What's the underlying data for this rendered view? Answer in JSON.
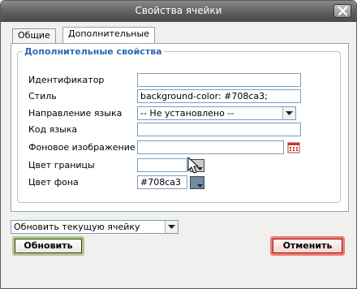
{
  "window": {
    "title": "Свойства ячейки"
  },
  "tabs": [
    {
      "label": "Общие"
    },
    {
      "label": "Дополнительные"
    }
  ],
  "fieldset": {
    "legend": "Дополнительные свойства"
  },
  "fields": {
    "id": {
      "label": "Идентификатор",
      "value": ""
    },
    "style": {
      "label": "Стиль",
      "value": "background-color: #708ca3;"
    },
    "dir": {
      "label": "Направление языка",
      "value": "-- Не установлено --"
    },
    "lang": {
      "label": "Код языка",
      "value": ""
    },
    "bgimage": {
      "label": "Фоновое изображение",
      "value": ""
    },
    "bordercolor": {
      "label": "Цвет границы",
      "value": ""
    },
    "bgcolor": {
      "label": "Цвет фона",
      "value": "#708ca3"
    }
  },
  "colors": {
    "bg_swatch": "#708ca3",
    "border_swatch": "#cccccc"
  },
  "action": {
    "value": "Обновить текущую ячейку"
  },
  "buttons": {
    "update": "Обновить",
    "cancel": "Отменить"
  }
}
